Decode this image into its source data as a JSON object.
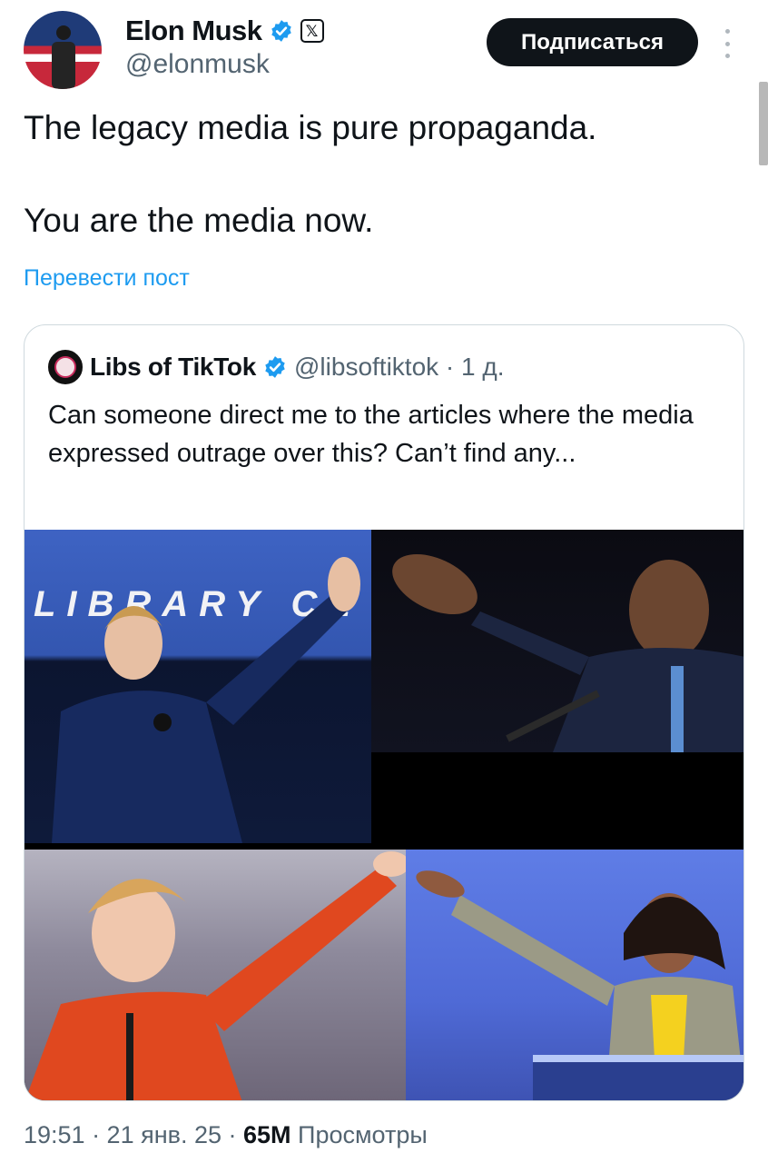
{
  "post": {
    "author_name": "Elon Musk",
    "author_handle": "@elonmusk",
    "xbadge_glyph": "𝕏",
    "follow_label": "Подписаться",
    "text_line1": "The legacy media is pure propaganda.",
    "text_line2": "You are the media now.",
    "translate_label": "Перевести пост",
    "timestamp": "19:51 · 21 янв. 25 · ",
    "views_count": "65M",
    "views_label": " Просмотры"
  },
  "quoted": {
    "author_name": "Libs of TikTok",
    "author_handle": "@libsoftiktok · 1 д.",
    "text": "Can someone direct me to the articles where the media expressed outrage over this? Can’t find any...",
    "sign_text": "LIBRARY CL"
  },
  "icons": {
    "verified": "verified-badge-icon",
    "more": "more-vertical-icon"
  },
  "colors": {
    "accent": "#1d9bf0",
    "text": "#0f1419",
    "muted": "#536471"
  }
}
